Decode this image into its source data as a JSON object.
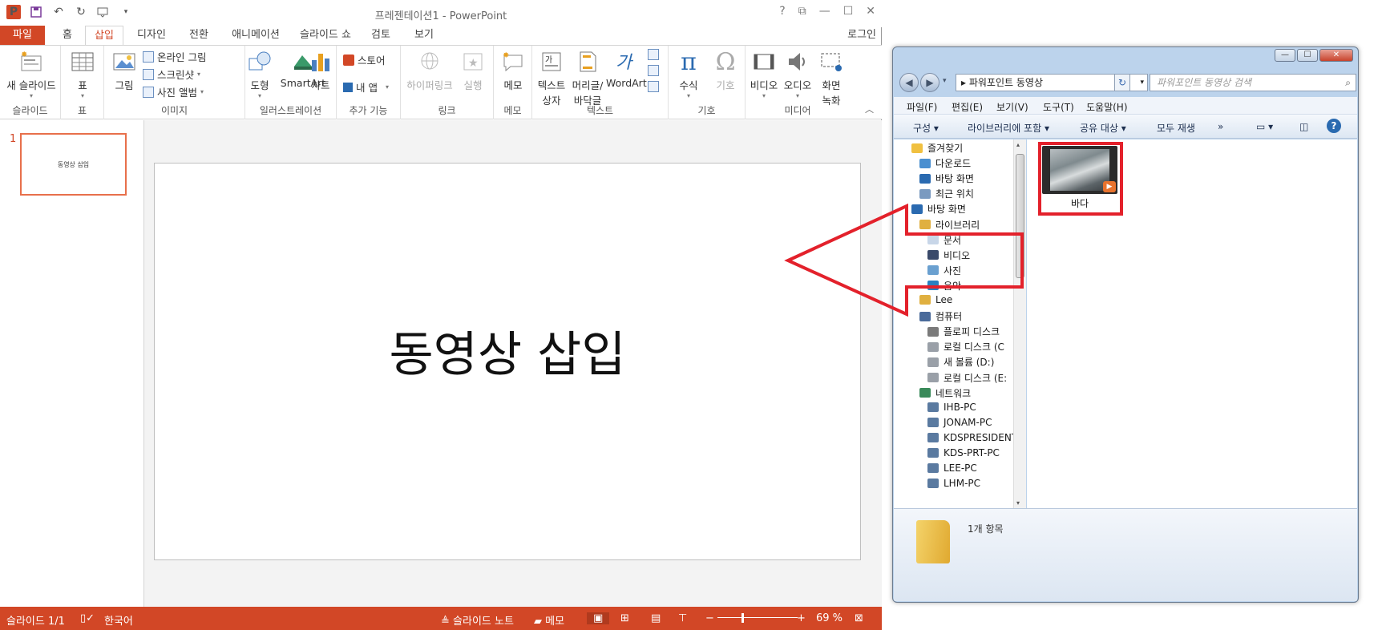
{
  "ppt": {
    "window_title": "프레젠테이션1 - PowerPoint",
    "qat": {
      "logo": "P",
      "save_icon": "save-icon",
      "undo": "↶",
      "redo": "↻"
    },
    "tabs": [
      {
        "label": "파일"
      },
      {
        "label": "홈"
      },
      {
        "label": "삽입"
      },
      {
        "label": "디자인"
      },
      {
        "label": "전환"
      },
      {
        "label": "애니메이션"
      },
      {
        "label": "슬라이드 쇼"
      },
      {
        "label": "검토"
      },
      {
        "label": "보기"
      }
    ],
    "login": "로그인",
    "ribbon": {
      "groups": {
        "slides": "슬라이드",
        "table": "표",
        "images": "이미지",
        "illustrations": "일러스트레이션",
        "addins": "추가 기능",
        "links": "링크",
        "comments": "메모",
        "text": "텍스트",
        "symbols": "기호",
        "media": "미디어"
      },
      "buttons": {
        "new_slide": "새 슬라이드",
        "table": "표",
        "picture": "그림",
        "online_picture": "온라인 그림",
        "screenshot": "스크린샷",
        "photo_album": "사진 앨범",
        "shapes": "도형",
        "smartart": "SmartArt",
        "chart": "차트",
        "store": "스토어",
        "my_apps": "내 앱",
        "hyperlink": "하이퍼링크",
        "action": "실행",
        "comment": "메모",
        "textbox_1": "텍스트",
        "textbox_2": "상자",
        "headerfooter_1": "머리글/",
        "headerfooter_2": "바닥글",
        "wordart": "WordArt",
        "equation": "수식",
        "symbol": "기호",
        "video": "비디오",
        "audio": "오디오",
        "screen_rec_1": "화면",
        "screen_rec_2": "녹화"
      }
    },
    "thumb": {
      "number": "1",
      "text": "동영상 삽입"
    },
    "slide_title": "동영상 삽입",
    "status": {
      "slide_count": "슬라이드 1/1",
      "language": "한국어",
      "notes": "슬라이드 노트",
      "comments": "메모",
      "zoom": "69 %"
    }
  },
  "explorer": {
    "address": "파워포인트 동영상",
    "search_placeholder": "파워포인트 동영상 검색",
    "menu": [
      "파일(F)",
      "편집(E)",
      "보기(V)",
      "도구(T)",
      "도움말(H)"
    ],
    "commands": [
      "구성 ▾",
      "라이브러리에 포함 ▾",
      "공유 대상 ▾",
      "모두 재생",
      "»"
    ],
    "nav": [
      {
        "label": "즐겨찾기",
        "level": 0
      },
      {
        "label": "다운로드",
        "level": 1
      },
      {
        "label": "바탕 화면",
        "level": 1
      },
      {
        "label": "최근 위치",
        "level": 1
      },
      {
        "label": "바탕 화면",
        "level": 0
      },
      {
        "label": "라이브러리",
        "level": 1
      },
      {
        "label": "문서",
        "level": 2
      },
      {
        "label": "비디오",
        "level": 2
      },
      {
        "label": "사진",
        "level": 2
      },
      {
        "label": "음악",
        "level": 2
      },
      {
        "label": "Lee",
        "level": 1
      },
      {
        "label": "컴퓨터",
        "level": 1
      },
      {
        "label": "플로피 디스크",
        "level": 2
      },
      {
        "label": "로컬 디스크 (C",
        "level": 2
      },
      {
        "label": "새 볼륨 (D:)",
        "level": 2
      },
      {
        "label": "로컬 디스크 (E:",
        "level": 2
      },
      {
        "label": "네트워크",
        "level": 1
      },
      {
        "label": "IHB-PC",
        "level": 2
      },
      {
        "label": "JONAM-PC",
        "level": 2
      },
      {
        "label": "KDSPRESIDENT",
        "level": 2
      },
      {
        "label": "KDS-PRT-PC",
        "level": 2
      },
      {
        "label": "LEE-PC",
        "level": 2
      },
      {
        "label": "LHM-PC",
        "level": 2
      }
    ],
    "file_name": "바다",
    "item_count": "1개 항목"
  },
  "colors": {
    "accent": "#d24726",
    "highlight": "#e3212b"
  }
}
